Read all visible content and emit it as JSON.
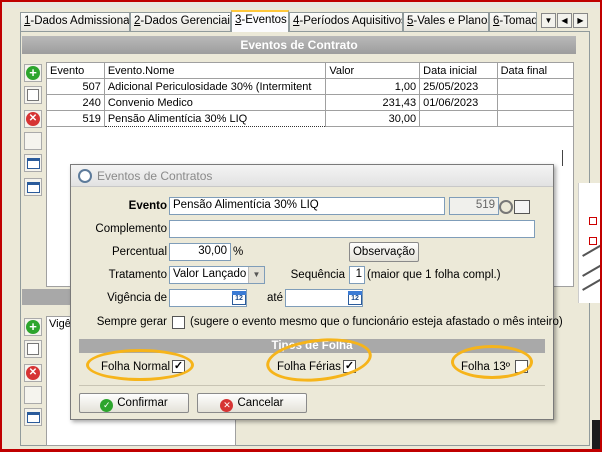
{
  "tabs": [
    {
      "num": "1",
      "label": "-Dados Admissionais",
      "active": false
    },
    {
      "num": "2",
      "label": "-Dados Gerenciais",
      "active": false
    },
    {
      "num": "3",
      "label": "-Eventos",
      "active": true
    },
    {
      "num": "4",
      "label": "-Períodos Aquisitivos",
      "active": false
    },
    {
      "num": "5",
      "label": "-Vales e Planos",
      "active": false
    },
    {
      "num": "6",
      "label": "-Tomad",
      "active": false
    }
  ],
  "section_title": "Eventos de Contrato",
  "table": {
    "headers": [
      "Evento",
      "Evento.Nome",
      "Valor",
      "Data inicial",
      "Data final"
    ],
    "rows": [
      [
        "507",
        "Adicional Periculosidade 30% (Intermitent",
        "1,00",
        "25/05/2023",
        ""
      ],
      [
        "240",
        "Convenio Medico",
        "231,43",
        "01/06/2023",
        ""
      ],
      [
        "519",
        "Pensão Alimentícia 30% LIQ",
        "30,00",
        "",
        ""
      ]
    ]
  },
  "lower_table": {
    "header": "Vigê"
  },
  "dialog": {
    "title": "Eventos de Contratos",
    "evento_label": "Evento",
    "evento_value": "Pensão Alimentícia 30% LIQ",
    "evento_code": "519",
    "complemento_label": "Complemento",
    "complemento_value": "",
    "percentual_label": "Percentual",
    "percentual_value": "30,00",
    "percentual_unit": "%",
    "observacao_button": "Observação",
    "tratamento_label": "Tratamento",
    "tratamento_value": "Valor Lançado",
    "sequencia_label": "Sequência",
    "sequencia_value": "1",
    "sequencia_hint": "(maior que 1 folha compl.)",
    "vigencia_label": "Vigência de",
    "ate_label": "até",
    "vigencia_from": "",
    "vigencia_to": "",
    "calendar_glyph": "12",
    "sempre_gerar_label": "Sempre gerar",
    "sempre_gerar_hint": "(sugere o evento mesmo que o funcionário esteja afastado o mês inteiro)",
    "sempre_gerar_checked": false,
    "tipos_header": "Tipos de Folha",
    "folha_normal_label": "Folha Normal",
    "folha_normal_checked": true,
    "folha_ferias_label": "Folha Férias",
    "folha_ferias_checked": true,
    "folha_13_label": "Folha 13º",
    "folha_13_checked": false,
    "confirmar_button": "Confirmar",
    "cancelar_button": "Cancelar"
  },
  "check_mark": "✓",
  "icons": [
    "add-icon",
    "edit-icon",
    "delete-icon",
    "window-icon",
    "search-icon",
    "document-icon",
    "calendar-icon",
    "confirm-icon",
    "cancel-icon"
  ],
  "colors": {
    "add": "#2da52d",
    "delete": "#d63434",
    "annotation": "#f6b41a",
    "frame": "#c00000",
    "active_tab": "#ffc83c"
  }
}
